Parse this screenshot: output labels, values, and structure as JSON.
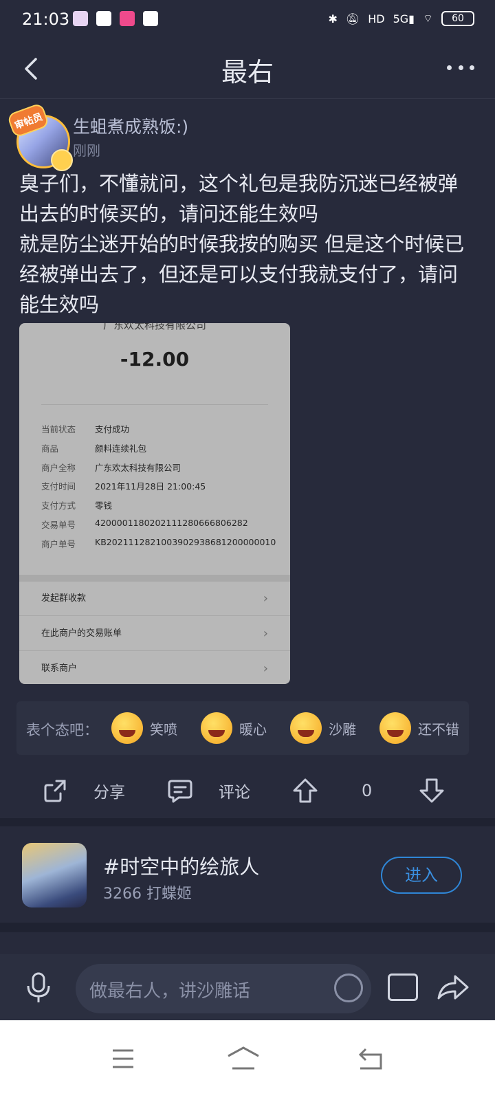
{
  "status": {
    "time": "21:03",
    "indicators": [
      "bluetooth-icon",
      "mute-icon",
      "hd-icon",
      "5g-signal-icon",
      "wifi-icon"
    ],
    "battery": "60"
  },
  "header": {
    "title": "最右"
  },
  "post": {
    "avatar_badge": "审帖员",
    "user_name": "生蛆煮成熟饭:)",
    "time": "刚刚",
    "text_lines": [
      "臭子们，不懂就问，这个礼包是我防沉迷已经被弹出去的时候买的，请问还能生效吗",
      "就是防尘迷开始的时候我按的购买 但是这个时候已经被弹出去了，但还是可以支付我就支付了，请问能生效吗"
    ]
  },
  "receipt": {
    "company_top": "广东欢太科技有限公司",
    "amount": "-12.00",
    "rows": [
      {
        "key": "当前状态",
        "value": "支付成功"
      },
      {
        "key": "商品",
        "value": "颜料连续礼包"
      },
      {
        "key": "商户全称",
        "value": "广东欢太科技有限公司"
      },
      {
        "key": "支付时间",
        "value": "2021年11月28日 21:00:45"
      },
      {
        "key": "支付方式",
        "value": "零钱"
      },
      {
        "key": "交易单号",
        "value": "4200001180202111280666806282"
      },
      {
        "key": "商户单号",
        "value": "KB2021112821003902938681200000010"
      }
    ],
    "actions": [
      "发起群收款",
      "在此商户的交易账单",
      "联系商户"
    ]
  },
  "reactions": {
    "prompt": "表个态吧：",
    "items": [
      {
        "label": "笑喷",
        "icon": "laughing-emoji-icon"
      },
      {
        "label": "暖心",
        "icon": "heart-hug-emoji-icon"
      },
      {
        "label": "沙雕",
        "icon": "silly-emoji-icon"
      },
      {
        "label": "还不错",
        "icon": "smirk-emoji-icon"
      }
    ]
  },
  "actions": {
    "share": "分享",
    "comment": "评论",
    "votes": "0"
  },
  "topic": {
    "name": "#时空中的绘旅人",
    "count": "3266 打蝶姬",
    "enter": "进入"
  },
  "composer": {
    "placeholder": "做最右人，讲沙雕话"
  }
}
